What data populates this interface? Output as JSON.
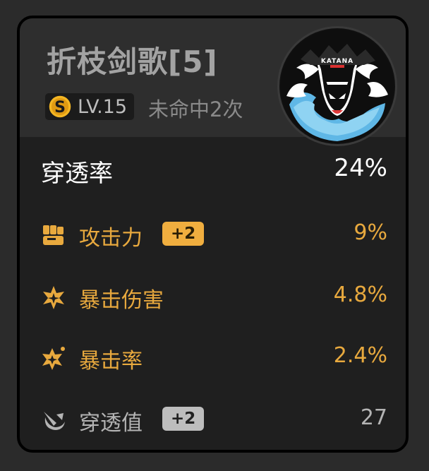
{
  "header": {
    "title": "折枝剑歌[5]",
    "level": "LV.15",
    "miss": "未命中2次",
    "disc_label": "KATANA"
  },
  "main_stat": {
    "label": "穿透率",
    "value": "24%"
  },
  "sub_stats": [
    {
      "label": "攻击力",
      "bonus": "+2",
      "value": "9%",
      "icon": "fist-icon"
    },
    {
      "label": "暴击伤害",
      "bonus": "",
      "value": "4.8%",
      "icon": "crit-damage-icon"
    },
    {
      "label": "暴击率",
      "bonus": "",
      "value": "2.4%",
      "icon": "crit-rate-icon"
    },
    {
      "label": "穿透值",
      "bonus": "+2",
      "value": "27",
      "icon": "pierce-icon"
    }
  ],
  "colors": {
    "gold": "#e8a93e",
    "grey": "#b4b4b4",
    "card_bg": "#1f1f1f",
    "header_bg": "#2e2e2e"
  }
}
